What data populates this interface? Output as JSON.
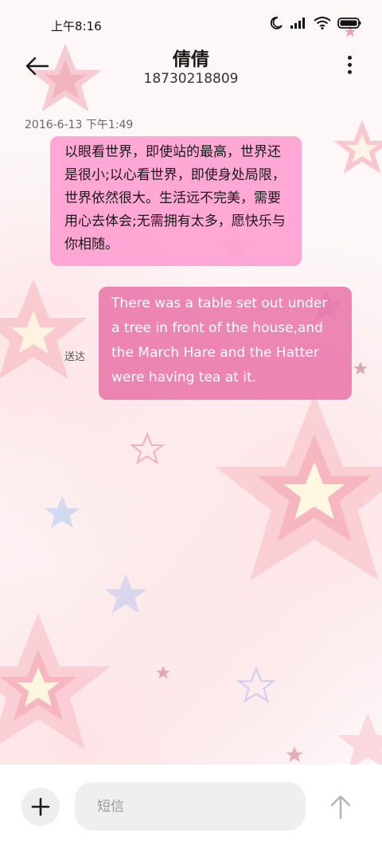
{
  "status_bar": {
    "time": "上午8:16",
    "icons": [
      "moon-icon",
      "signal-icon",
      "wifi-icon",
      "battery-icon"
    ]
  },
  "header": {
    "contact_name": "倩倩",
    "phone_number": "18730218809",
    "back_icon": "arrow-left-icon",
    "more_icon": "more-vertical-icon"
  },
  "conversation": {
    "timestamp": "2016-6-13 下午1:49",
    "messages": [
      {
        "direction": "incoming",
        "text": "以眼看世界，即使站的最高，世界还是很小;以心看世界，即使身处局限，世界依然很大。生活远不完美，需要用心去体会;无需拥有太多，愿快乐与你相随。"
      },
      {
        "direction": "outgoing",
        "text": "There was a table set out under a tree in front of the house,and the March Hare and the Hatter were having tea at it.",
        "status": "送达"
      }
    ]
  },
  "composer": {
    "placeholder": "短信",
    "add_icon": "plus-icon",
    "send_icon": "arrow-up-icon"
  },
  "colors": {
    "incoming_bubble": "#ffa0d2",
    "outgoing_bubble": "#e86ea5"
  }
}
